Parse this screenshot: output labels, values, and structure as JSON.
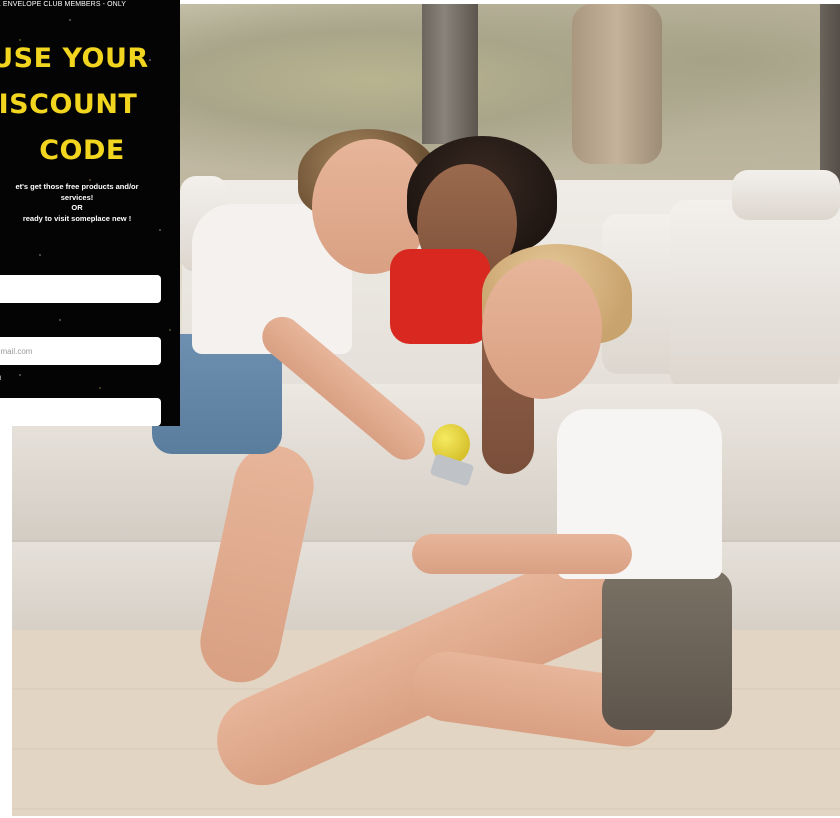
{
  "promo": {
    "banner": "K ENVELOPE CLUB MEMBERS - ONLY",
    "headline": [
      "USE YOUR",
      "ISCOUNT",
      "CODE"
    ],
    "description": [
      "et's get those free products and/or",
      "services!",
      "OR",
      "ready to visit someplace new !"
    ],
    "fields": [
      {
        "value": "",
        "placeholder": ""
      },
      {
        "value": "",
        "placeholder": "gmail.com"
      },
      {
        "value": "",
        "placeholder": ""
      }
    ],
    "tiny_label": "d",
    "colors": {
      "panel_bg": "#040404",
      "headline": "#f2d51e",
      "text": "#ffffff"
    }
  },
  "hero": {
    "content": "photo"
  }
}
